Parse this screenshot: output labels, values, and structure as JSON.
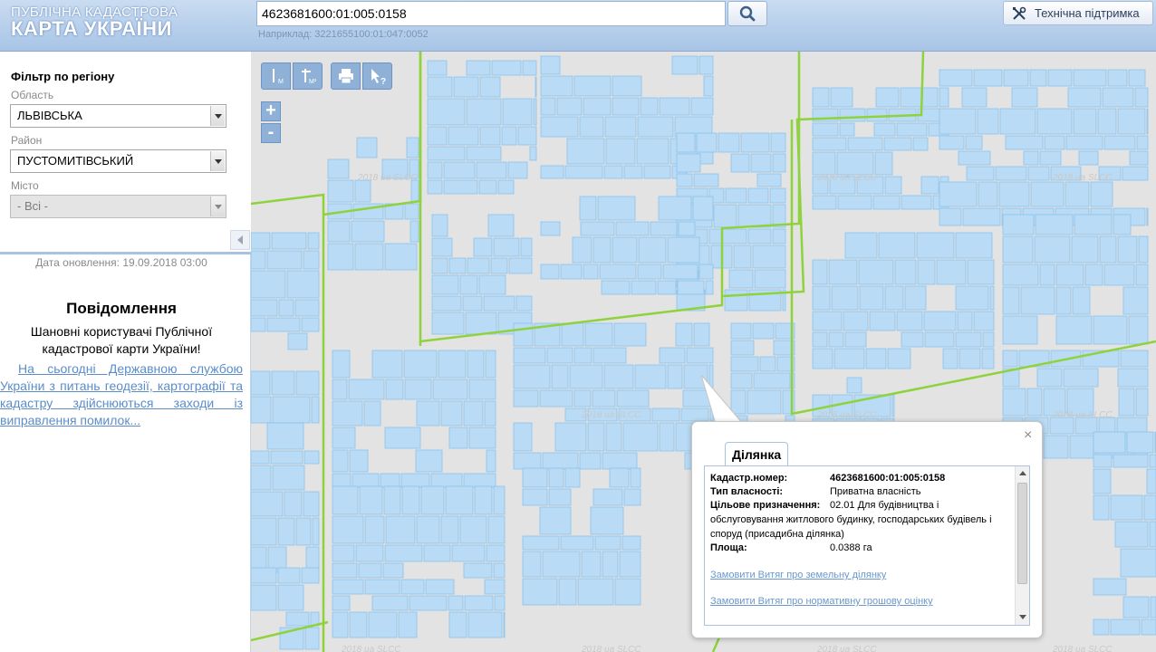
{
  "header": {
    "logo_line1": "ПУБЛІЧНА КАДАСТРОВА",
    "logo_line2": "КАРТА УКРАЇНИ",
    "search_value": "4623681600:01:005:0158",
    "search_example": "Наприклад: 3221655100:01:047:0052",
    "support_label": "Технічна підтримка",
    "search_icon": "magnifier-icon",
    "support_icon": "tools-icon"
  },
  "sidebar": {
    "filter_title": "Фільтр по регіону",
    "oblast_label": "Область",
    "oblast_value": "ЛЬВІВСЬКА",
    "raion_label": "Район",
    "raion_value": "ПУСТОМИТІВСЬКИЙ",
    "misto_label": "Місто",
    "misto_value": "- Всі -",
    "update_date": "Дата оновлення: 19.09.2018 03:00",
    "notice_title": "Повідомлення",
    "notice_text": "Шановні користувачі Публічної кадастрової карти України!",
    "notice_link": "На сьогодні Державною службою України з питань геодезії, картографії та кадастру здійснюються заходи із виправлення помилок..."
  },
  "map": {
    "toolbar": [
      {
        "name": "measure-length-button",
        "icon": "ruler-m-icon"
      },
      {
        "name": "measure-area-button",
        "icon": "ruler-m2-icon"
      },
      {
        "name": "print-button",
        "icon": "printer-icon"
      },
      {
        "name": "identify-button",
        "icon": "cursor-question-icon"
      }
    ],
    "zoom_in": "+",
    "zoom_out": "-",
    "watermark": "2018 ua SLCC",
    "colors": {
      "background": "#e3e3e3",
      "parcel_fill": "#b9dbf5",
      "parcel_stroke": "#8cc2ea",
      "boundary": "#8ed23c"
    }
  },
  "popup": {
    "tab_label": "Ділянка",
    "close_label": "×",
    "rows": [
      {
        "key": "Кадастр.номер:",
        "value": "4623681600:01:005:0158"
      },
      {
        "key": "Тип власності:",
        "value": "Приватна власність"
      },
      {
        "key": "Цільове призначення:",
        "value_line1": "02.01 Для будівництва і",
        "value_rest_1": "обслуговування житлового будинку, господарських будівель і",
        "value_rest_2": "споруд (присадибна ділянка)"
      },
      {
        "key": "Площа:",
        "value": "0.0388 га"
      }
    ],
    "link_extract": "Замовити Витяг про земельну ділянку",
    "link_valuation": "Замовити Витяг про нормативну грошову оцінку"
  }
}
